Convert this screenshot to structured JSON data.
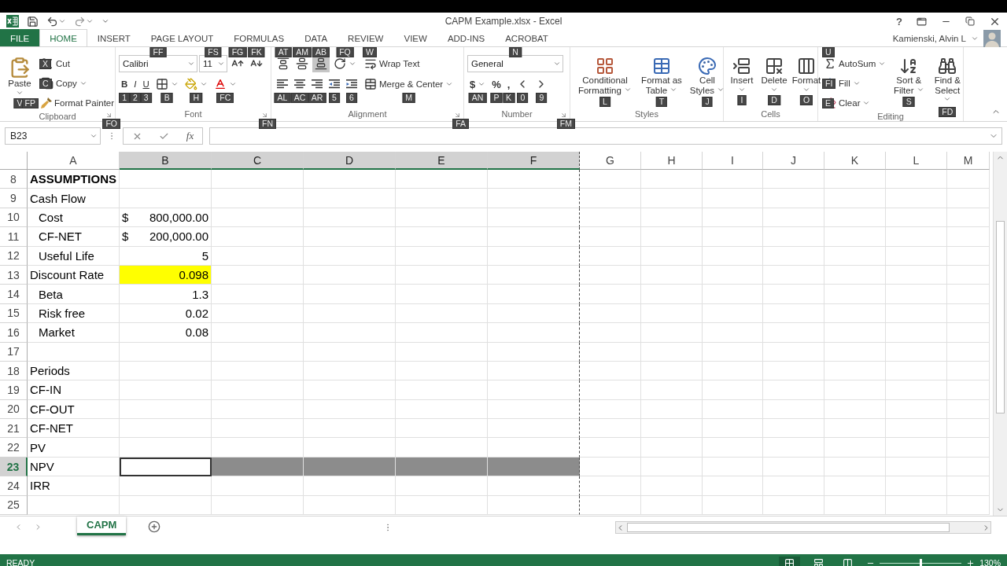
{
  "window": {
    "title": "CAPM Example.xlsx - Excel",
    "help": "?",
    "user": "Kamienski, Alvin L"
  },
  "ribbon_tabs": [
    {
      "label": "FILE",
      "kind": "file",
      "selected": false
    },
    {
      "label": "HOME",
      "kind": "tab",
      "selected": true
    },
    {
      "label": "INSERT",
      "kind": "tab",
      "selected": false
    },
    {
      "label": "PAGE LAYOUT",
      "kind": "tab",
      "selected": false
    },
    {
      "label": "FORMULAS",
      "kind": "tab",
      "selected": false
    },
    {
      "label": "DATA",
      "kind": "tab",
      "selected": false
    },
    {
      "label": "REVIEW",
      "kind": "tab",
      "selected": false
    },
    {
      "label": "VIEW",
      "kind": "tab",
      "selected": false
    },
    {
      "label": "ADD-INS",
      "kind": "tab",
      "selected": false
    },
    {
      "label": "ACROBAT",
      "kind": "tab",
      "selected": false
    }
  ],
  "ribbon_groups": [
    {
      "label": "Clipboard",
      "launcher_keytip": "FO",
      "controls": [
        {
          "label": "Paste",
          "keytip": "V"
        },
        {
          "label": "Cut",
          "keytip": "X"
        },
        {
          "label": "Copy",
          "keytip": "C"
        },
        {
          "label": "Format Painter",
          "keytip": "FP"
        }
      ]
    },
    {
      "label": "Font",
      "launcher_keytip": "FN",
      "controls": [
        {
          "value": "Calibri",
          "keytip": "FF"
        },
        {
          "value": "11",
          "keytip": "FS"
        },
        {
          "keytip": "FG"
        },
        {
          "keytip": "FK"
        },
        {
          "label": "B",
          "keytip": "1"
        },
        {
          "label": "I",
          "keytip": "2"
        },
        {
          "label": "U",
          "keytip": "3"
        },
        {
          "keytip": "B"
        },
        {
          "keytip": "H"
        },
        {
          "keytip": "FC"
        }
      ]
    },
    {
      "label": "Alignment",
      "launcher_keytip": "FA",
      "controls": [
        {
          "keytip": "AT",
          "selected": false
        },
        {
          "keytip": "AM",
          "selected": false
        },
        {
          "keytip": "AB",
          "selected": true
        },
        {
          "keytip": "FQ",
          "selected": false
        },
        {
          "keytip": "AL",
          "selected": false
        },
        {
          "keytip": "AC",
          "selected": false
        },
        {
          "keytip": "AR",
          "selected": false
        },
        {
          "keytip": "5",
          "selected": false
        },
        {
          "keytip": "6",
          "selected": false
        },
        {
          "label": "Wrap Text",
          "keytip": "W",
          "selected": false
        },
        {
          "label": "Merge & Center",
          "keytip": "M",
          "selected": false
        }
      ]
    },
    {
      "label": "Number",
      "launcher_keytip": "FM",
      "controls": [
        {
          "value": "General",
          "keytip": "N"
        },
        {
          "label": "$",
          "keytip": "AN"
        },
        {
          "label": "%",
          "keytip": "P"
        },
        {
          "label": ",",
          "keytip": "K"
        },
        {
          "keytip": "0"
        },
        {
          "keytip": "9"
        }
      ]
    },
    {
      "label": "Styles",
      "controls": [
        {
          "label": "Conditional Formatting",
          "keytip": "L"
        },
        {
          "label": "Format as Table",
          "keytip": "T"
        },
        {
          "label": "Cell Styles",
          "keytip": "J"
        }
      ]
    },
    {
      "label": "Cells",
      "controls": [
        {
          "label": "Insert",
          "keytip": "I"
        },
        {
          "label": "Delete",
          "keytip": "D"
        },
        {
          "label": "Format",
          "keytip": "O"
        }
      ]
    },
    {
      "label": "Editing",
      "controls": [
        {
          "label": "AutoSum",
          "keytip": "U"
        },
        {
          "label": "Fill",
          "keytip": "FI"
        },
        {
          "label": "Clear",
          "keytip": "E"
        },
        {
          "label": "Sort & Filter",
          "keytip": "S"
        },
        {
          "label": "Find & Select",
          "keytip": "FD"
        }
      ]
    }
  ],
  "formula_bar": {
    "name_box": "B23",
    "function_label": "fx"
  },
  "columns": [
    {
      "label": "A",
      "selected": false,
      "page_break": false
    },
    {
      "label": "B",
      "selected": true,
      "page_break": false
    },
    {
      "label": "C",
      "selected": true,
      "page_break": false
    },
    {
      "label": "D",
      "selected": true,
      "page_break": false
    },
    {
      "label": "E",
      "selected": true,
      "page_break": false
    },
    {
      "label": "F",
      "selected": true,
      "page_break": true
    },
    {
      "label": "G",
      "selected": false,
      "page_break": false
    },
    {
      "label": "H",
      "selected": false,
      "page_break": false
    },
    {
      "label": "I",
      "selected": false,
      "page_break": false
    },
    {
      "label": "J",
      "selected": false,
      "page_break": false
    },
    {
      "label": "K",
      "selected": false,
      "page_break": false
    },
    {
      "label": "L",
      "selected": false,
      "page_break": false
    },
    {
      "label": "M",
      "selected": false,
      "page_break": false
    }
  ],
  "rows": [
    {
      "number": "8",
      "selected": false,
      "cells": [
        {
          "text": "ASSUMPTIONS",
          "bold": true,
          "indented": false
        }
      ]
    },
    {
      "number": "9",
      "selected": false,
      "cells": [
        {
          "text": "Cash Flow",
          "bold": false,
          "indented": false
        }
      ]
    },
    {
      "number": "10",
      "selected": false,
      "cells": [
        {
          "text": "Cost",
          "bold": false,
          "indented": true
        },
        {
          "currency": "$",
          "text": "800,000.00",
          "highlighted": false
        }
      ]
    },
    {
      "number": "11",
      "selected": false,
      "cells": [
        {
          "text": "CF-NET",
          "bold": false,
          "indented": true
        },
        {
          "currency": "$",
          "text": "200,000.00",
          "highlighted": false
        }
      ]
    },
    {
      "number": "12",
      "selected": false,
      "cells": [
        {
          "text": "Useful Life",
          "bold": false,
          "indented": true
        },
        {
          "text": "5",
          "highlighted": false
        }
      ]
    },
    {
      "number": "13",
      "selected": false,
      "cells": [
        {
          "text": "Discount Rate",
          "bold": false,
          "indented": false
        },
        {
          "text": "0.098",
          "highlighted": true
        }
      ]
    },
    {
      "number": "14",
      "selected": false,
      "cells": [
        {
          "text": "Beta",
          "bold": false,
          "indented": true
        },
        {
          "text": "1.3",
          "highlighted": false
        }
      ]
    },
    {
      "number": "15",
      "selected": false,
      "cells": [
        {
          "text": "Risk free",
          "bold": false,
          "indented": true
        },
        {
          "text": "0.02",
          "highlighted": false
        }
      ]
    },
    {
      "number": "16",
      "selected": false,
      "cells": [
        {
          "text": "Market",
          "bold": false,
          "indented": true
        },
        {
          "text": "0.08",
          "highlighted": false
        }
      ]
    },
    {
      "number": "17",
      "selected": false,
      "cells": []
    },
    {
      "number": "18",
      "selected": false,
      "cells": [
        {
          "text": "Periods",
          "bold": false,
          "indented": false
        }
      ]
    },
    {
      "number": "19",
      "selected": false,
      "cells": [
        {
          "text": "CF-IN",
          "bold": false,
          "indented": false
        }
      ]
    },
    {
      "number": "20",
      "selected": false,
      "cells": [
        {
          "text": "CF-OUT",
          "bold": false,
          "indented": false
        }
      ]
    },
    {
      "number": "21",
      "selected": false,
      "cells": [
        {
          "text": "CF-NET",
          "bold": false,
          "indented": false
        }
      ]
    },
    {
      "number": "22",
      "selected": false,
      "cells": [
        {
          "text": "PV",
          "bold": false,
          "indented": false
        }
      ]
    },
    {
      "number": "23",
      "selected": true,
      "cells": [
        {
          "text": "NPV",
          "bold": false,
          "indented": false
        },
        {
          "active": true,
          "highlighted": false
        }
      ]
    },
    {
      "number": "24",
      "selected": false,
      "cells": [
        {
          "text": "IRR",
          "bold": false,
          "indented": false
        }
      ]
    },
    {
      "number": "25",
      "selected": false,
      "cells": []
    }
  ],
  "sheet_tabs": [
    {
      "label": "CAPM",
      "selected": true
    }
  ],
  "status_bar": {
    "status": "READY",
    "views": [
      {
        "kind": "normal",
        "selected": true
      },
      {
        "kind": "page_layout",
        "selected": false
      },
      {
        "kind": "page_break",
        "selected": false
      }
    ],
    "zoom": {
      "level": 0.5,
      "reading": "130%"
    }
  }
}
